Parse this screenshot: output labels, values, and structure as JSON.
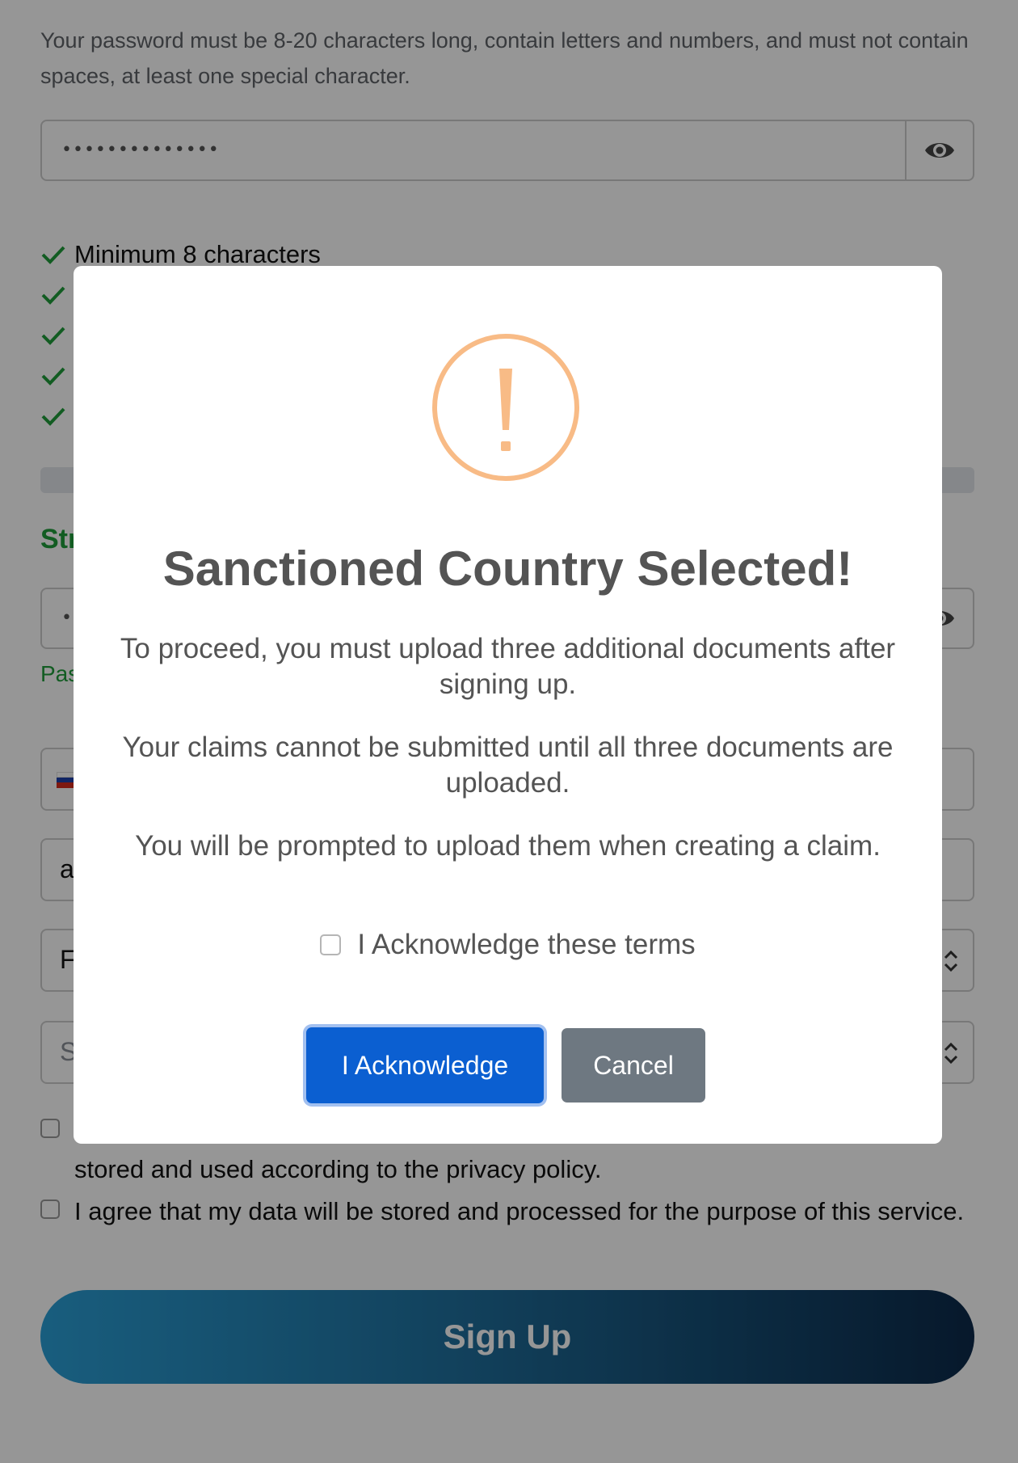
{
  "form": {
    "password_hint": "Your password must be 8-20 characters long, contain letters and numbers, and must not contain spaces, at least one special character.",
    "password_value": "••••••••••••••",
    "confirm_value": "••••••••••••••",
    "requirements": [
      {
        "label": "Minimum 8 characters",
        "met": true
      },
      {
        "label": "",
        "met": true
      },
      {
        "label": "",
        "met": true
      },
      {
        "label": "",
        "met": true
      },
      {
        "label": "",
        "met": true
      }
    ],
    "strength_label": "Str",
    "match_label": "Pas",
    "country_flag": "russia-flag",
    "address_value": "a",
    "select1_value": "F",
    "select2_placeholder": "S",
    "consents": [
      {
        "text": "stored and used according to the privacy policy.",
        "checked": false
      },
      {
        "text": "I agree that my data will be stored and processed for the purpose of this service.",
        "checked": false
      }
    ],
    "signup_label": "Sign Up"
  },
  "modal": {
    "icon": "exclamation-circle-icon",
    "title": "Sanctioned Country Selected!",
    "paragraphs": [
      "To proceed, you must upload three additional documents after signing up.",
      "Your claims cannot be submitted until all three documents are uploaded.",
      "You will be prompted to upload them when creating a claim."
    ],
    "acknowledge_checkbox_label": "I Acknowledge these terms",
    "acknowledge_checked": false,
    "confirm_button": "I Acknowledge",
    "cancel_button": "Cancel"
  },
  "colors": {
    "warning": "#f8bb86",
    "confirm": "#0b5fd1",
    "cancel": "#6e7881",
    "success": "#1f9d3a"
  }
}
